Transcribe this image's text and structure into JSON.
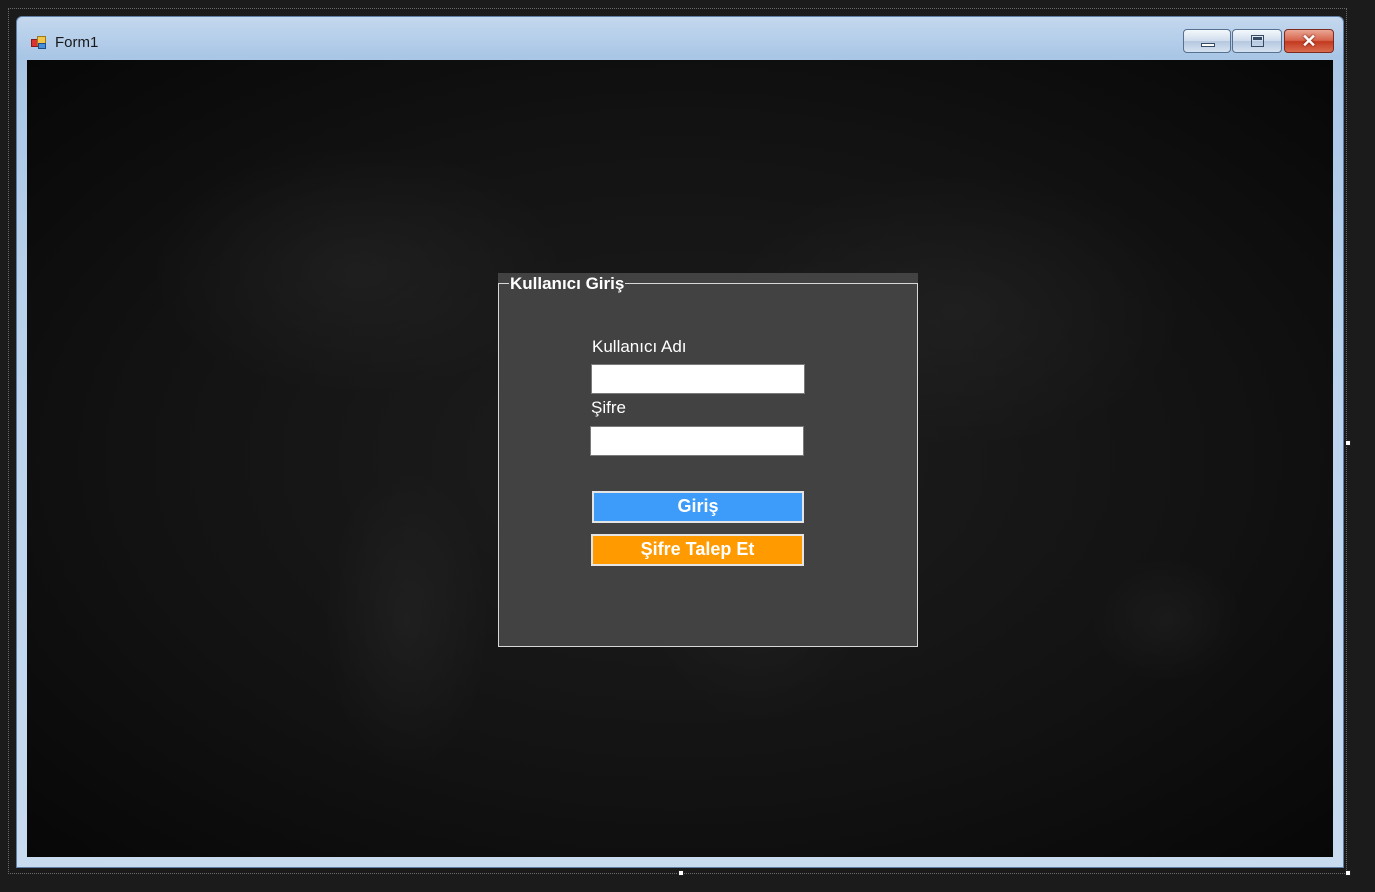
{
  "window": {
    "title": "Form1"
  },
  "title_buttons": {
    "close_glyph": "✕"
  },
  "login_group": {
    "title": "Kullanıcı Giriş",
    "username_label": "Kullanıcı Adı",
    "username_value": "",
    "password_label": "Şifre",
    "password_value": "",
    "login_button": "Giriş",
    "request_password_button": "Şifre Talep Et"
  },
  "colors": {
    "login_button": "#3d9bfa",
    "request_button": "#ff9a00",
    "group_background": "#424242"
  },
  "icons": {
    "app": "windows-form-icon",
    "minimize": "minimize-icon",
    "maximize": "maximize-icon",
    "close": "close-icon"
  }
}
